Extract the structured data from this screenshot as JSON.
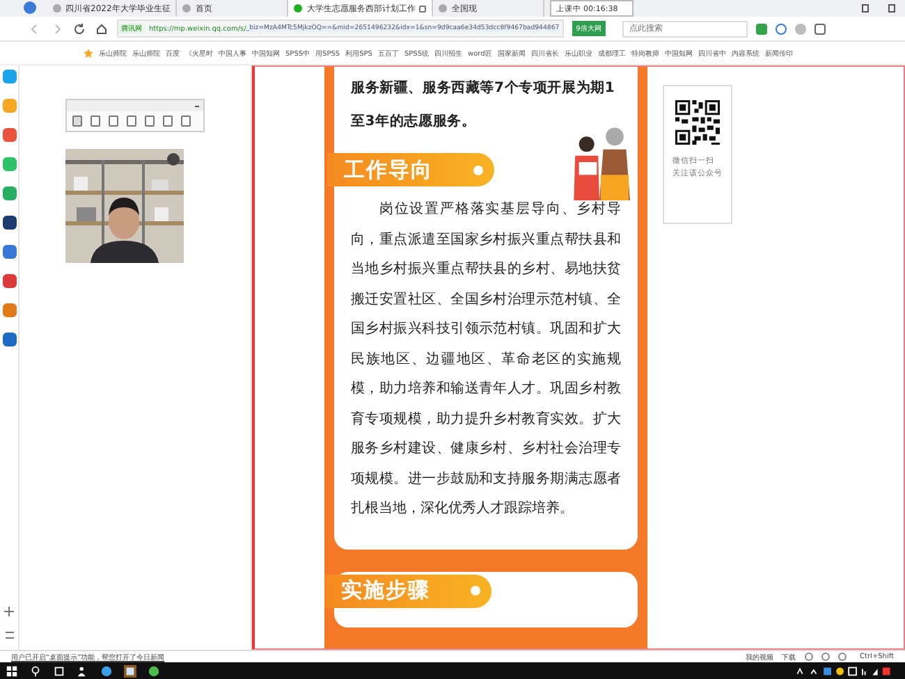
{
  "browser": {
    "tabs": [
      {
        "title": "四川省2022年大学毕业生征",
        "selected": false
      },
      {
        "title": "首页",
        "selected": false
      },
      {
        "title": "大学生志愿服务西部计划工作",
        "selected": true
      },
      {
        "title": "全国现",
        "selected": false
      }
    ],
    "timer": "上课中 00:16:38",
    "address": {
      "badge": "腾讯网",
      "url": "https://mp.weixin.qq.com/s/",
      "url_selected": "_biz=MzA4MTc5MjkzOQ==&mid=2651496232&idx=1&sn=9d9caa6e34d53dcc8f9467bad944867",
      "action": "9倍大网"
    },
    "search": {
      "placeholder": "点此搜索"
    },
    "bookmarks": [
      "乐山师院",
      "乐山师院",
      "百度",
      "《火星时",
      "中国人事",
      "中国知网",
      "SPSS中",
      "用SPSS",
      "利用SPS",
      "五百丁",
      "SPSS统",
      "四川招生",
      "word匠",
      "国家新闻",
      "四川省长",
      "乐山职业",
      "成都理工",
      "特岗教师",
      "中国知网",
      "四川省中",
      "内容系统",
      "新闻传印"
    ]
  },
  "article": {
    "intro": "服务新疆、服务西藏等7个专项开展为期1至3年的志愿服务。",
    "sections": [
      {
        "heading": "工作导向",
        "body": "岗位设置严格落实基层导向、乡村导向，重点派遣至国家乡村振兴重点帮扶县和当地乡村振兴重点帮扶县的乡村、易地扶贫搬迁安置社区、全国乡村治理示范村镇、全国乡村振兴科技引领示范村镇。巩固和扩大民族地区、边疆地区、革命老区的实施规模，助力培养和输送青年人才。巩固乡村教育专项规模，助力提升乡村教育实效。扩大服务乡村建设、健康乡村、乡村社会治理专项规模。进一步鼓励和支持服务期满志愿者扎根当地，深化优秀人才跟踪培养。"
      },
      {
        "heading": "实施步骤"
      }
    ]
  },
  "qr_card": {
    "lines": [
      "微信扫一扫",
      "关注该公众号"
    ]
  },
  "status_bar": {
    "message": "用户已开启“桌面提示”功能，帮您打开了今日新闻",
    "items": [
      "我的视频",
      "下载"
    ]
  },
  "shortcut_hint": "Ctrl+Shift"
}
